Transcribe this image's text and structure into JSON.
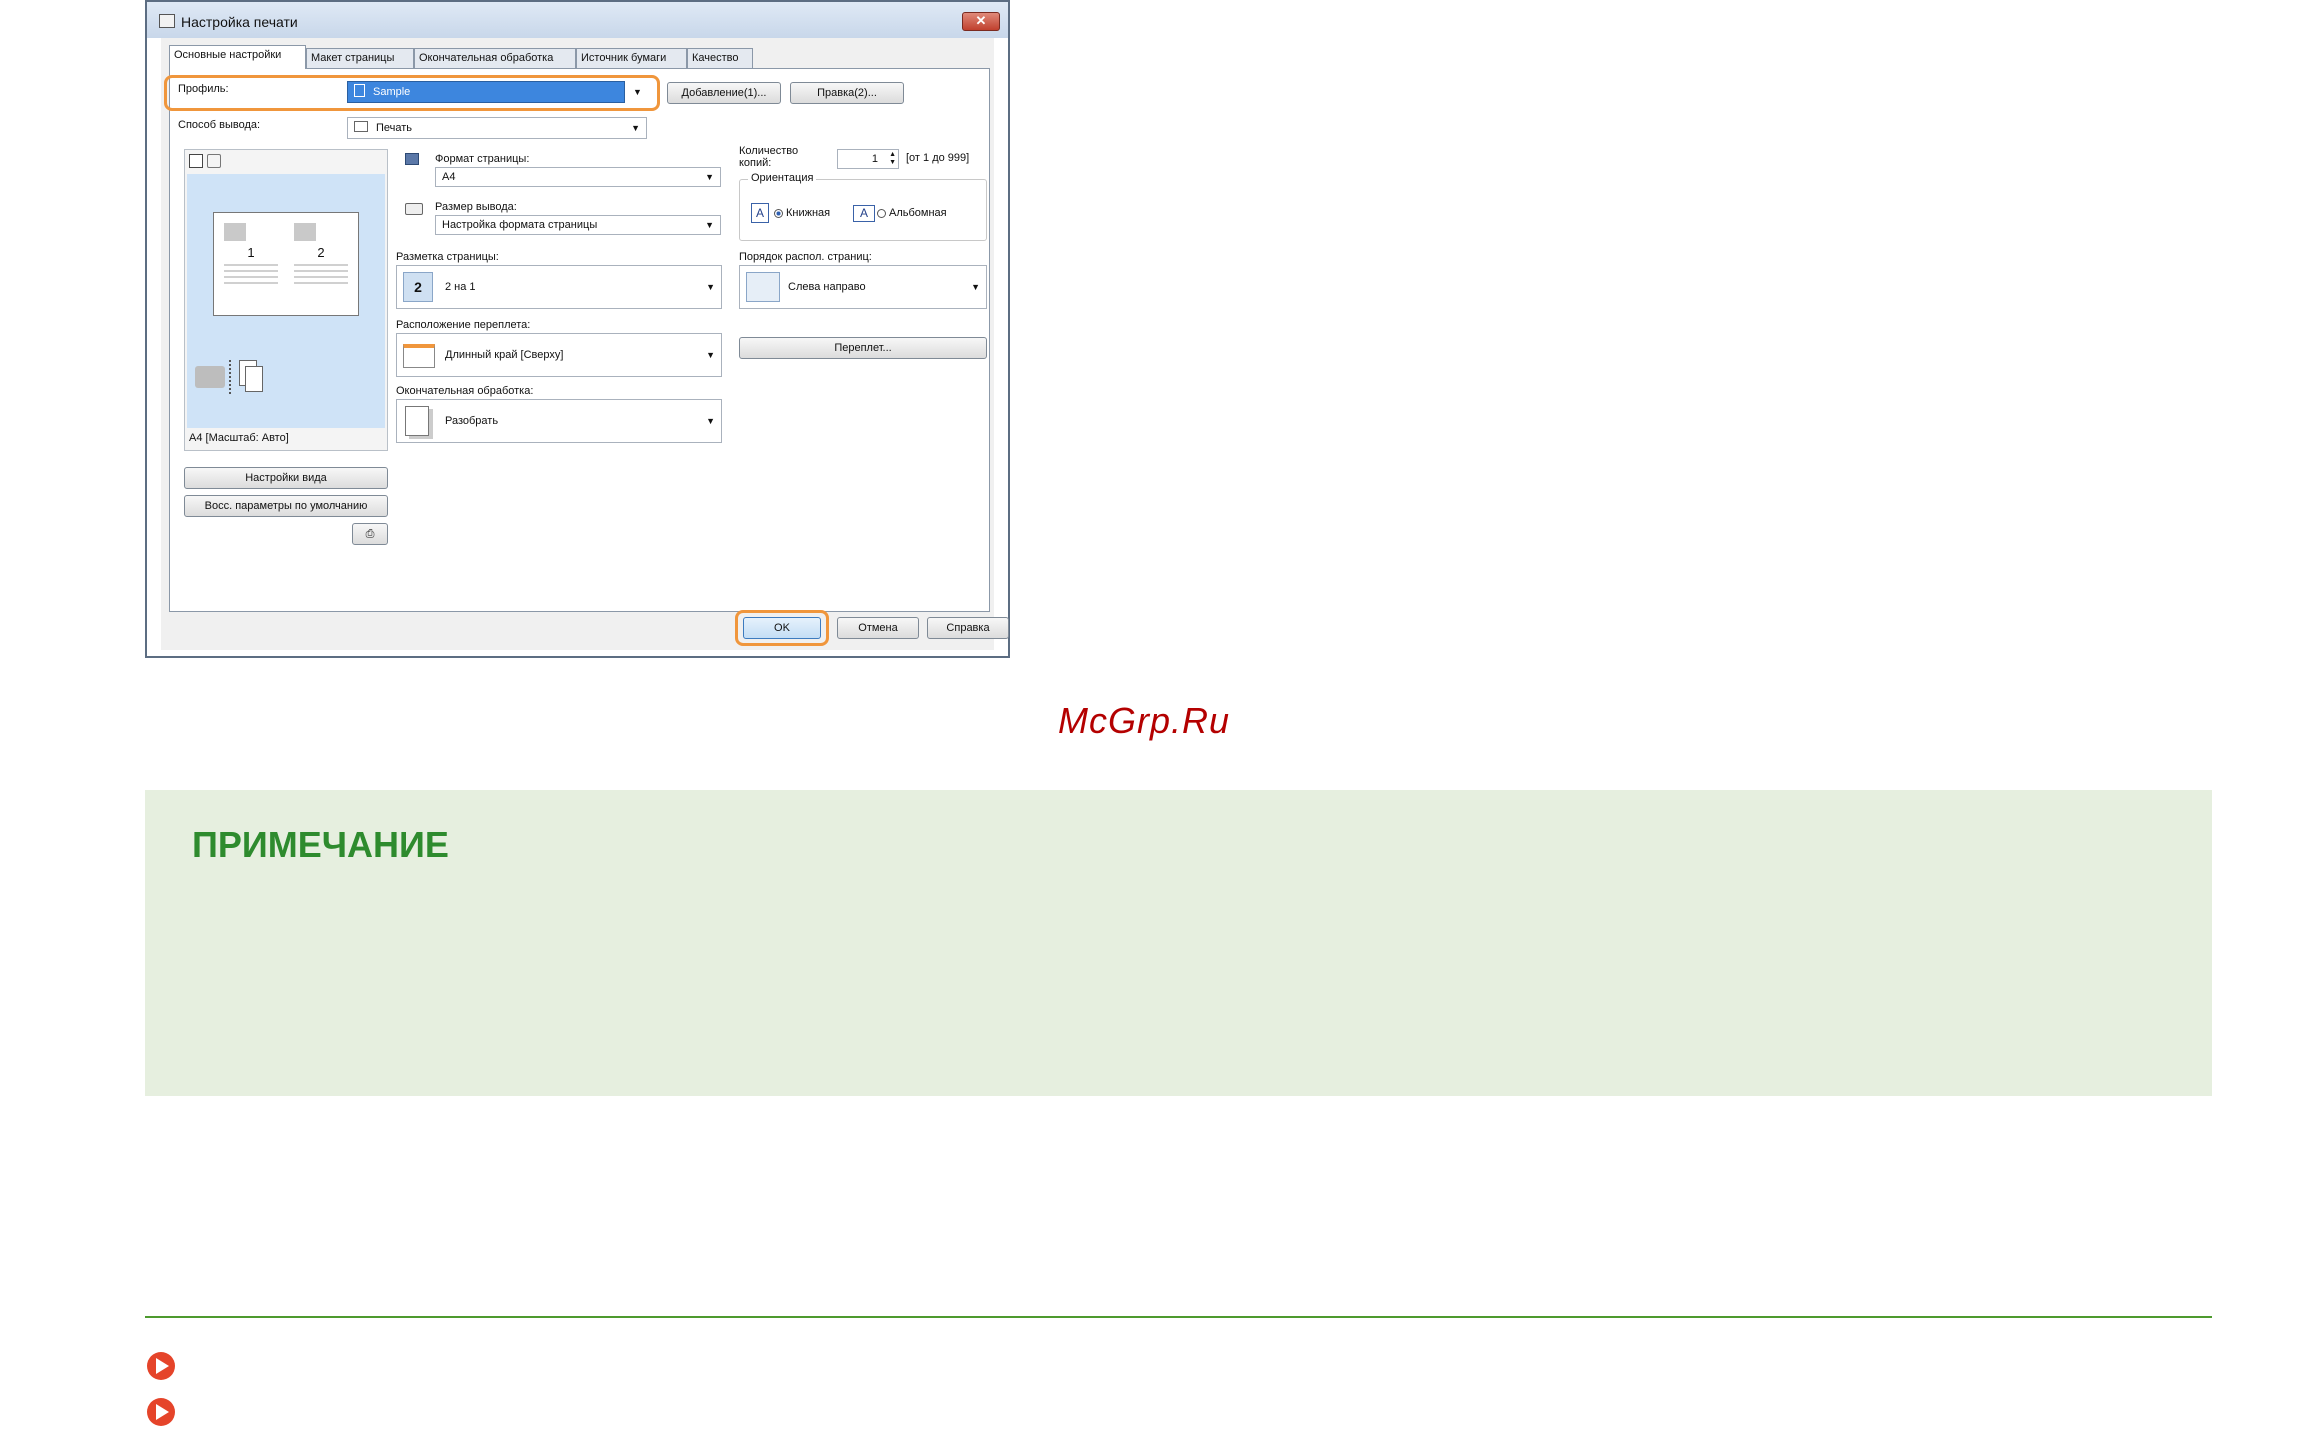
{
  "dialog": {
    "title": "Настройка печати",
    "tabs": [
      "Основные настройки",
      "Макет страницы",
      "Окончательная обработка",
      "Источник бумаги",
      "Качество"
    ],
    "profile_label": "Профиль:",
    "profile_value": "Sample",
    "add_button": "Добавление(1)...",
    "edit_button": "Правка(2)...",
    "output_label": "Способ вывода:",
    "output_value": "Печать",
    "preview_caption": "A4 [Масштаб: Авто]",
    "preview_page_numbers": [
      "1",
      "2"
    ],
    "page_size_label": "Формат страницы:",
    "page_size_value": "A4",
    "output_size_label": "Размер вывода:",
    "output_size_value": "Настройка формата страницы",
    "copies_label": "Количество копий:",
    "copies_value": "1",
    "copies_range": "[от 1 до 999]",
    "orientation_label": "Ориентация",
    "orientation_portrait": "Книжная",
    "orientation_landscape": "Альбомная",
    "orientation_selected": "portrait",
    "layout_label": "Разметка страницы:",
    "layout_icon_text": "2",
    "layout_value": "2 на 1",
    "page_order_label": "Порядок распол. страниц:",
    "page_order_value": "Слева направо",
    "binding_label": "Расположение переплета:",
    "binding_value": "Длинный край [Сверху]",
    "binding_button": "Переплет...",
    "finishing_label": "Окончательная обработка:",
    "finishing_value": "Разобрать",
    "view_settings_button": "Настройки вида",
    "restore_defaults_button": "Восс. параметры по умолчанию",
    "ok_button": "OK",
    "cancel_button": "Отмена",
    "help_button": "Справка"
  },
  "watermark": "McGrp.Ru",
  "note": {
    "title": "ПРИМЕЧАНИЕ"
  },
  "colors": {
    "highlight": "#f0963c",
    "note_bg": "#e6efdf",
    "note_title": "#2e8b2e",
    "rule": "#4d9a2e",
    "bullet": "#e5442a",
    "watermark": "#b40000"
  }
}
